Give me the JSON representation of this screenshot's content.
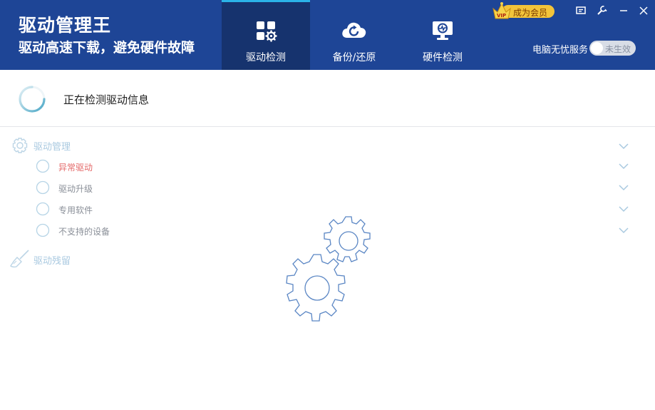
{
  "app": {
    "title": "驱动管理王",
    "slogan": "驱动高速下载，避免硬件故障"
  },
  "tabs": [
    {
      "label": "驱动检测",
      "active": true,
      "icon": "grid-gear-icon"
    },
    {
      "label": "备份/还原",
      "active": false,
      "icon": "cloud-refresh-icon"
    },
    {
      "label": "硬件检测",
      "active": false,
      "icon": "monitor-check-icon"
    }
  ],
  "vip": {
    "label": "成为会员",
    "badge": "VIP"
  },
  "window_controls": [
    "feedback-icon",
    "settings-wrench-icon",
    "minimize-icon",
    "close-icon"
  ],
  "service": {
    "label": "电脑无忧服务",
    "toggle_text": "未生效",
    "enabled": false
  },
  "status": {
    "text": "正在检测驱动信息"
  },
  "tree": {
    "management": {
      "label": "驱动管理",
      "icon": "gear-icon"
    },
    "items": [
      {
        "label": "异常驱动",
        "color": "#e46a6a"
      },
      {
        "label": "驱动升级",
        "color": "#8a8f98"
      },
      {
        "label": "专用软件",
        "color": "#8a8f98"
      },
      {
        "label": "不支持的设备",
        "color": "#8a8f98"
      }
    ],
    "residue": {
      "label": "驱动残留",
      "icon": "broom-icon"
    }
  },
  "colors": {
    "header": "#1e4596",
    "active_tab": "#16336e",
    "accent": "#2bb3e8",
    "muted_blue": "#a9c9e0",
    "gear_stroke": "#4d7fc0"
  }
}
